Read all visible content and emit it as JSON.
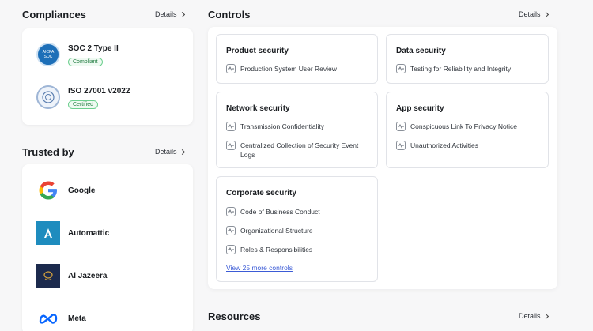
{
  "compliances": {
    "title": "Compliances",
    "details_label": "Details",
    "items": [
      {
        "name": "SOC 2 Type II",
        "status": "Compliant",
        "badge_text": "AICPA SOC"
      },
      {
        "name": "ISO 27001 v2022",
        "status": "Certified"
      }
    ]
  },
  "trusted_by": {
    "title": "Trusted by",
    "details_label": "Details",
    "items": [
      {
        "name": "Google"
      },
      {
        "name": "Automattic"
      },
      {
        "name": "Al Jazeera"
      },
      {
        "name": "Meta"
      }
    ]
  },
  "controls": {
    "title": "Controls",
    "details_label": "Details",
    "groups": [
      {
        "title": "Product security",
        "items": [
          "Production System User Review"
        ]
      },
      {
        "title": "Data security",
        "items": [
          "Testing for Reliability and Integrity"
        ]
      },
      {
        "title": "Network security",
        "items": [
          "Transmission Confidentiality",
          "Centralized Collection of Security Event Logs"
        ]
      },
      {
        "title": "App security",
        "items": [
          "Conspicuous Link To Privacy Notice",
          "Unauthorized Activities"
        ]
      },
      {
        "title": "Corporate security",
        "items": [
          "Code of Business Conduct",
          "Organizational Structure",
          "Roles & Responsibilities"
        ]
      }
    ],
    "view_more": "View 25 more controls"
  },
  "resources": {
    "title": "Resources",
    "details_label": "Details"
  },
  "colors": {
    "accent_link": "#3b5bd6",
    "status_green": "#1f7a3f",
    "google_blue": "#4285f4",
    "automattic_blue": "#1e8cbe",
    "meta_blue": "#0866ff"
  }
}
